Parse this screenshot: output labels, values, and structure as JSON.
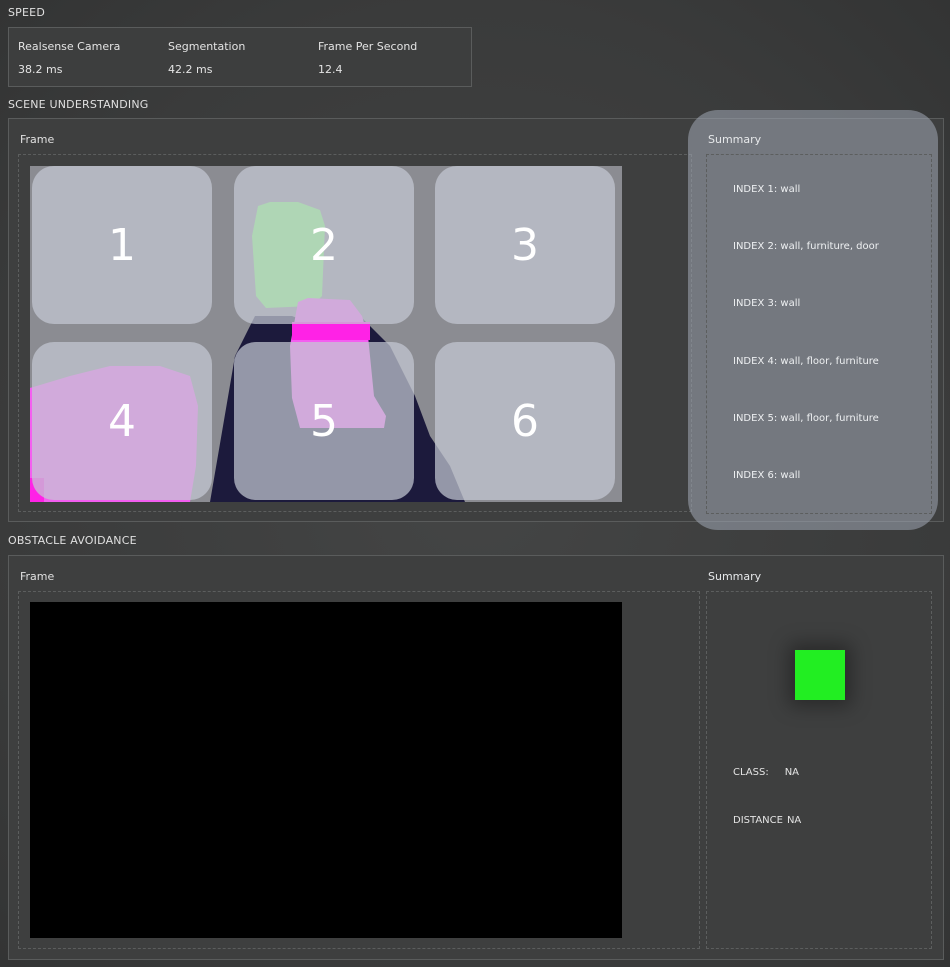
{
  "speed": {
    "title": "SPEED",
    "metrics": [
      {
        "label": "Realsense Camera",
        "value": "38.2 ms"
      },
      {
        "label": "Segmentation",
        "value": "42.2 ms"
      },
      {
        "label": "Frame Per Second",
        "value": "12.4"
      }
    ]
  },
  "scene": {
    "title": "SCENE UNDERSTANDING",
    "frame_label": "Frame",
    "summary_label": "Summary",
    "cells": [
      "1",
      "2",
      "3",
      "4",
      "5",
      "6"
    ],
    "index_lines": [
      "INDEX 1:  wall",
      "INDEX 2:  wall, furniture, door",
      "INDEX 3:  wall",
      "INDEX 4:  wall, floor, furniture",
      "INDEX 5:  wall, floor, furniture",
      "INDEX 6:  wall"
    ]
  },
  "obstacle": {
    "title": "OBSTACLE AVOIDANCE",
    "frame_label": "Frame",
    "summary_label": "Summary",
    "indicator_color": "#22ee22",
    "class_label": "CLASS:",
    "class_value": "NA",
    "distance_label": "DISTANCE",
    "distance_value": "NA"
  }
}
